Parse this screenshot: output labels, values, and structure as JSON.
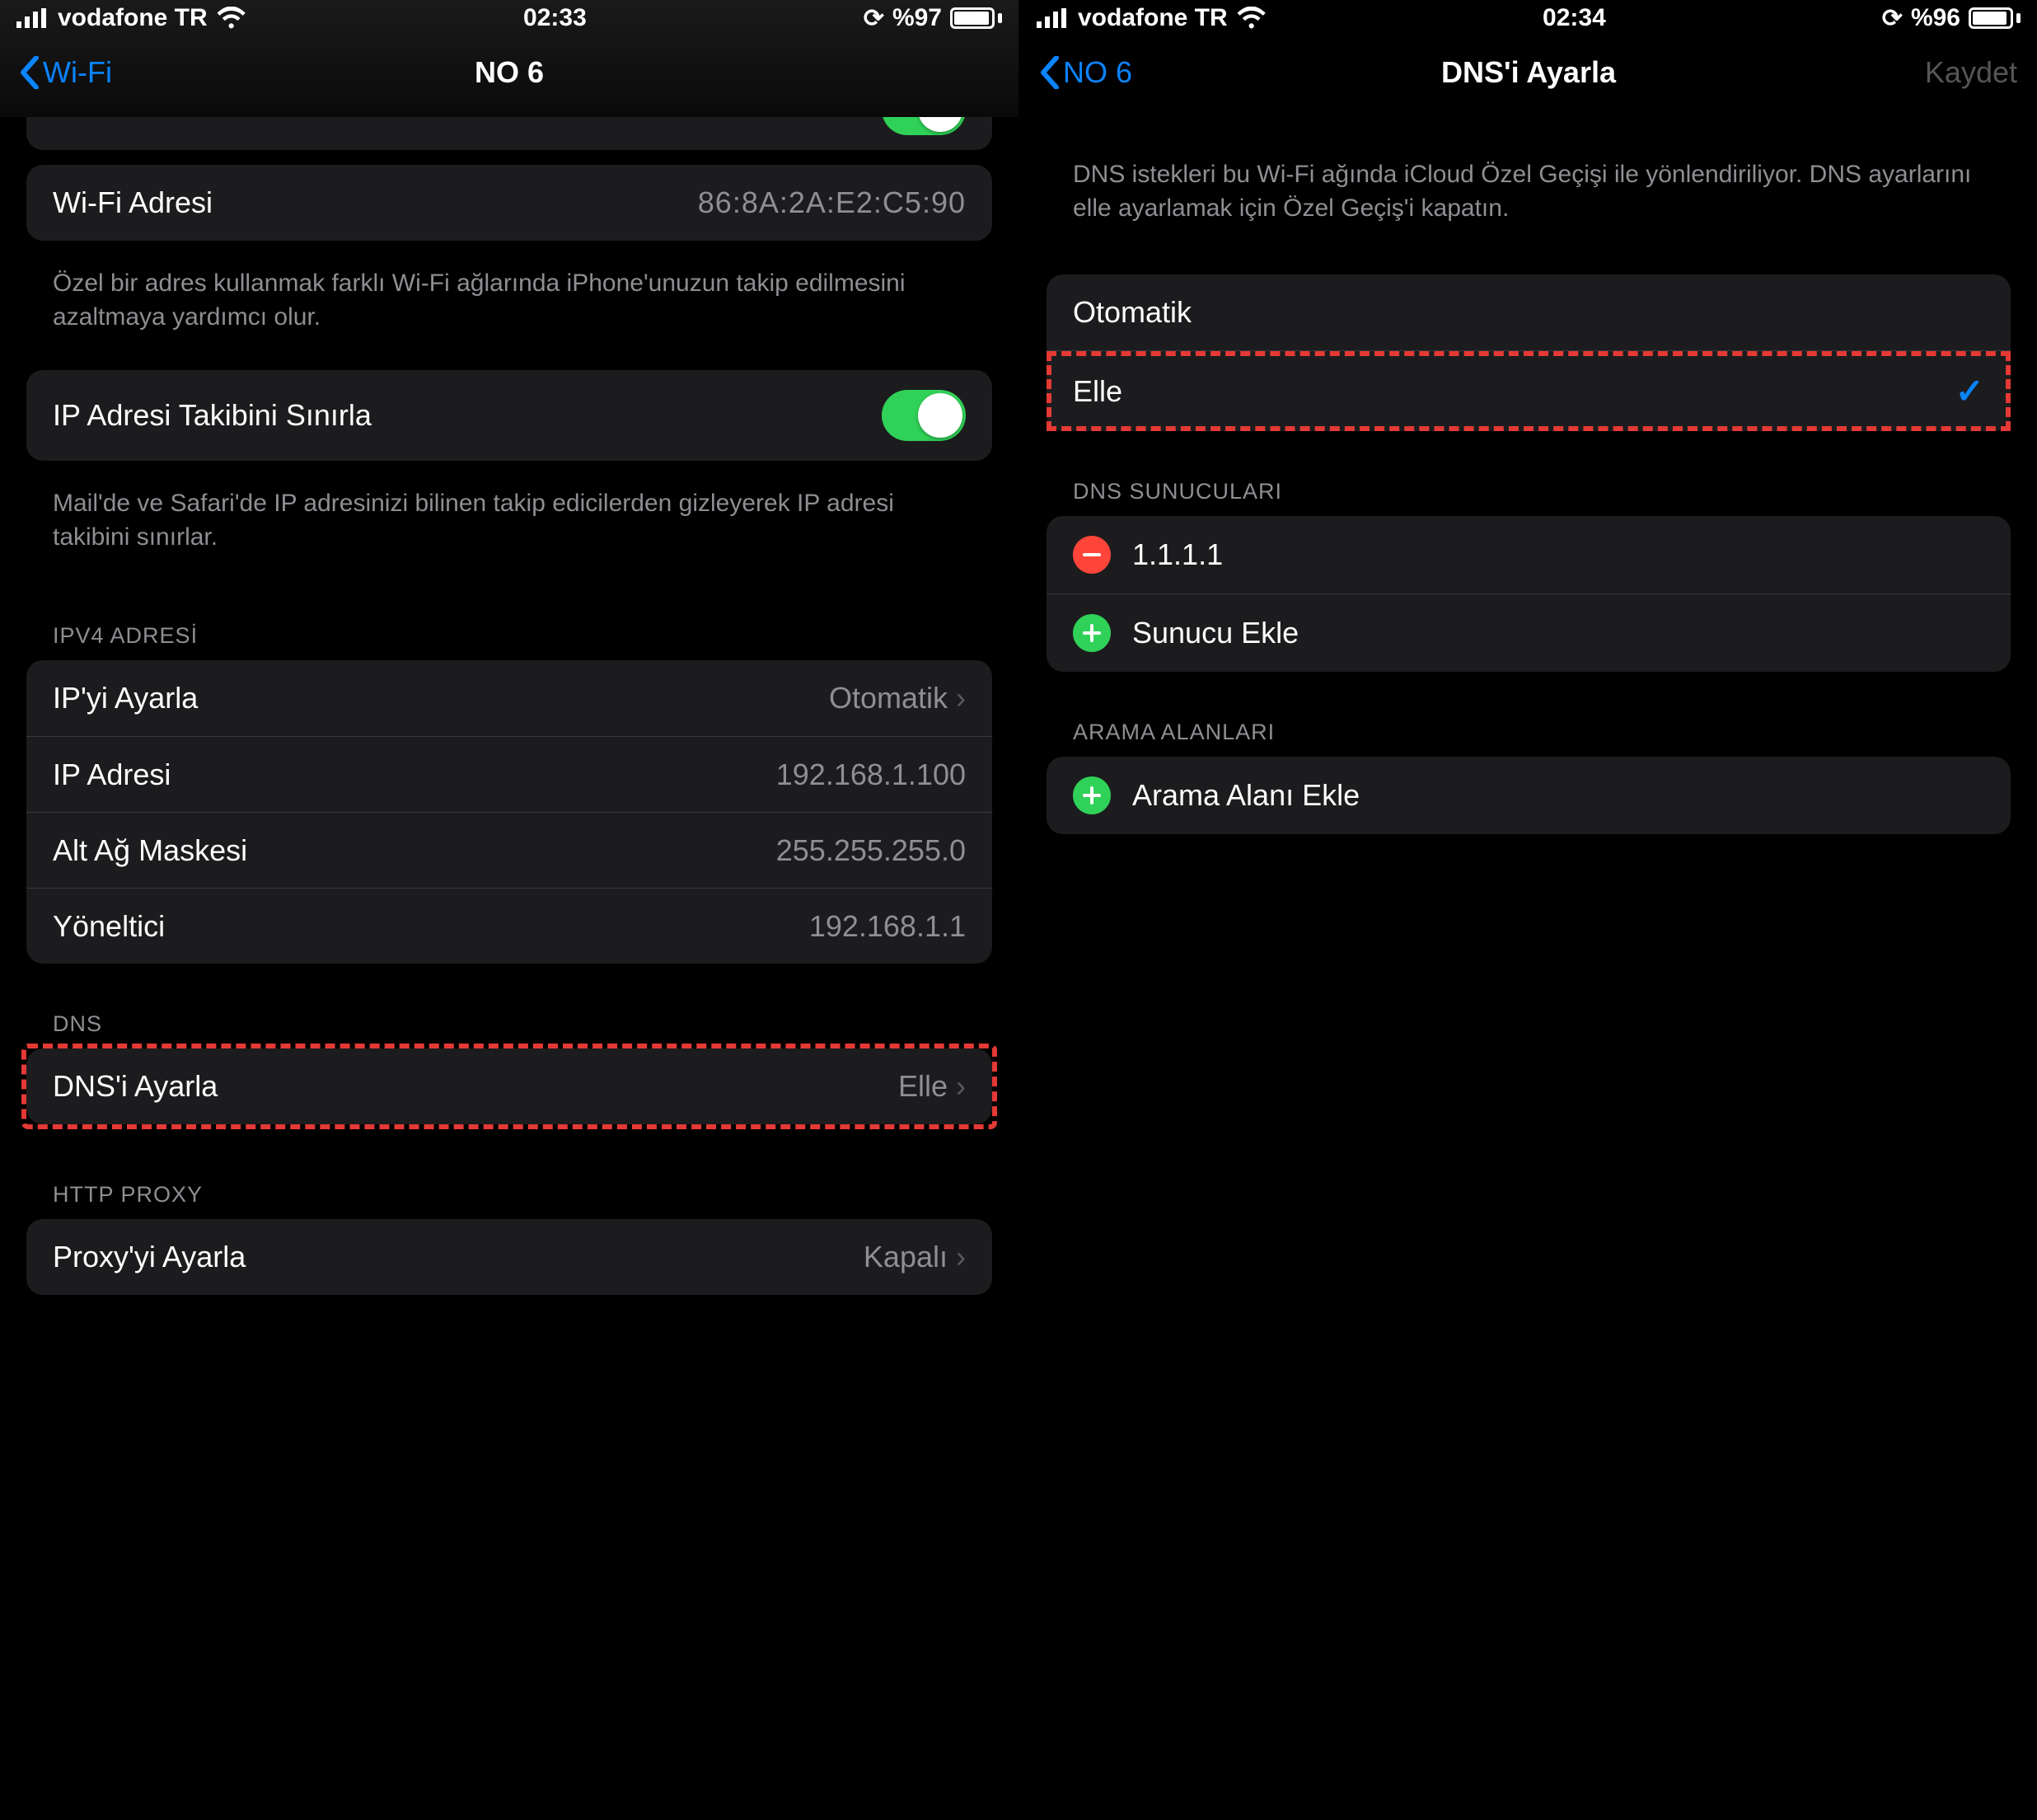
{
  "left": {
    "status": {
      "carrier": "vodafone TR",
      "time": "02:33",
      "battery": "%97"
    },
    "nav": {
      "back": "Wi-Fi",
      "title": "NO 6"
    },
    "wifi_address": {
      "label": "Wi-Fi Adresi",
      "value": "86:8A:2A:E2:C5:90"
    },
    "wifi_address_footer": "Özel bir adres kullanmak farklı Wi-Fi ağlarında iPhone'unuzun takip edilmesini azaltmaya yardımcı olur.",
    "limit_ip": {
      "label": "IP Adresi Takibini Sınırla",
      "on": true
    },
    "limit_ip_footer": "Mail'de ve Safari'de IP adresinizi bilinen takip edicilerden gizleyerek IP adresi takibini sınırlar.",
    "ipv4_header": "IPV4 ADRESİ",
    "ipv4": {
      "configure": {
        "label": "IP'yi Ayarla",
        "value": "Otomatik"
      },
      "ip": {
        "label": "IP Adresi",
        "value": "192.168.1.100"
      },
      "mask": {
        "label": "Alt Ağ Maskesi",
        "value": "255.255.255.0"
      },
      "router": {
        "label": "Yöneltici",
        "value": "192.168.1.1"
      }
    },
    "dns_header": "DNS",
    "dns_configure": {
      "label": "DNS'i Ayarla",
      "value": "Elle"
    },
    "proxy_header": "HTTP PROXY",
    "proxy_configure": {
      "label": "Proxy'yi Ayarla",
      "value": "Kapalı"
    }
  },
  "right": {
    "status": {
      "carrier": "vodafone TR",
      "time": "02:34",
      "battery": "%96"
    },
    "nav": {
      "back": "NO 6",
      "title": "DNS'i Ayarla",
      "save": "Kaydet"
    },
    "info_text": "DNS istekleri bu Wi-Fi ağında iCloud Özel Geçişi ile yönlendiriliyor. DNS ayarlarını elle ayarlamak için Özel Geçiş'i kapatın.",
    "mode": {
      "auto": "Otomatik",
      "manual": "Elle"
    },
    "servers_header": "DNS SUNUCULARI",
    "servers": {
      "entry1": "1.1.1.1",
      "add": "Sunucu Ekle"
    },
    "search_header": "ARAMA ALANLARI",
    "search_add": "Arama Alanı Ekle"
  }
}
